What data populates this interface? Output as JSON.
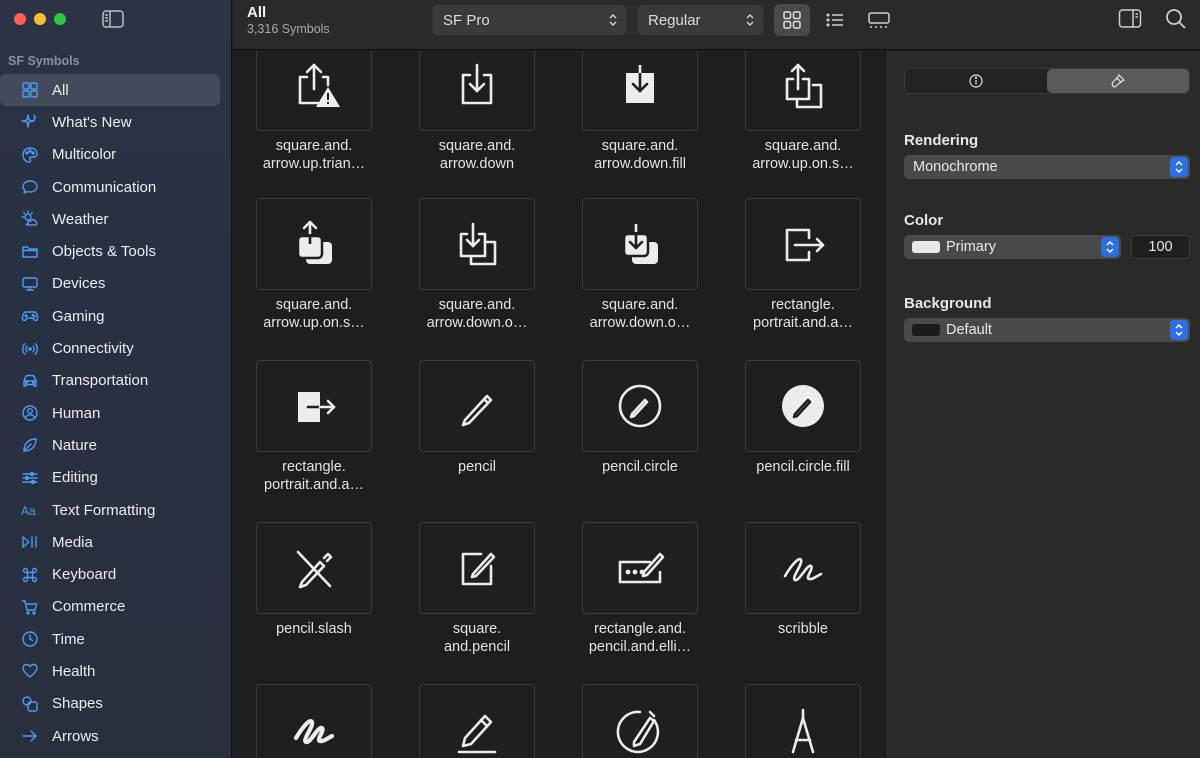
{
  "window": {
    "title": "All",
    "subtitle": "3,316 Symbols"
  },
  "sidebar": {
    "section": "SF Symbols",
    "items": [
      {
        "label": "All",
        "icon": "grid-icon",
        "active": true
      },
      {
        "label": "What's New",
        "icon": "sparkle-icon"
      },
      {
        "label": "Multicolor",
        "icon": "palette-icon"
      },
      {
        "label": "Communication",
        "icon": "message-bubble-icon"
      },
      {
        "label": "Weather",
        "icon": "sun-cloud-icon"
      },
      {
        "label": "Objects & Tools",
        "icon": "folder-icon"
      },
      {
        "label": "Devices",
        "icon": "display-icon"
      },
      {
        "label": "Gaming",
        "icon": "gamecontroller-icon"
      },
      {
        "label": "Connectivity",
        "icon": "antenna-icon"
      },
      {
        "label": "Transportation",
        "icon": "car-icon"
      },
      {
        "label": "Human",
        "icon": "person-icon"
      },
      {
        "label": "Nature",
        "icon": "leaf-icon"
      },
      {
        "label": "Editing",
        "icon": "sliders-icon"
      },
      {
        "label": "Text Formatting",
        "icon": "text-aa-icon"
      },
      {
        "label": "Media",
        "icon": "play-pause-icon"
      },
      {
        "label": "Keyboard",
        "icon": "command-icon"
      },
      {
        "label": "Commerce",
        "icon": "cart-icon"
      },
      {
        "label": "Time",
        "icon": "clock-icon"
      },
      {
        "label": "Health",
        "icon": "heart-icon"
      },
      {
        "label": "Shapes",
        "icon": "shapes-icon"
      },
      {
        "label": "Arrows",
        "icon": "arrow-right-icon"
      }
    ]
  },
  "toolbar": {
    "font_popup": "SF Pro",
    "weight_popup": "Regular",
    "view_modes": [
      "grid-view-icon",
      "list-view-icon",
      "gallery-view-icon"
    ]
  },
  "symbols": [
    {
      "name": "square.and.\narrow.up.trian…",
      "icon": "square-arrow-up-triangle-icon"
    },
    {
      "name": "square.and.\narrow.down",
      "icon": "square-arrow-down-icon"
    },
    {
      "name": "square.and.\narrow.down.fill",
      "icon": "square-arrow-down-fill-icon"
    },
    {
      "name": "square.and.\narrow.up.on.s…",
      "icon": "square-arrow-up-on-square-icon"
    },
    {
      "name": "square.and.\narrow.up.on.s…",
      "icon": "square-arrow-up-on-square-fill-icon"
    },
    {
      "name": "square.and.\narrow.down.o…",
      "icon": "square-arrow-down-on-square-icon"
    },
    {
      "name": "square.and.\narrow.down.o…",
      "icon": "square-arrow-down-on-square-fill-icon"
    },
    {
      "name": "rectangle.\nportrait.and.a…",
      "icon": "rectangle-portrait-arrow-right-icon"
    },
    {
      "name": "rectangle.\nportrait.and.a…",
      "icon": "rectangle-portrait-arrow-right-fill-icon"
    },
    {
      "name": "pencil",
      "icon": "pencil-icon"
    },
    {
      "name": "pencil.circle",
      "icon": "pencil-circle-icon"
    },
    {
      "name": "pencil.circle.fill",
      "icon": "pencil-circle-fill-icon"
    },
    {
      "name": "pencil.slash",
      "icon": "pencil-slash-icon"
    },
    {
      "name": "square.\nand.pencil",
      "icon": "square-and-pencil-icon"
    },
    {
      "name": "rectangle.and.\npencil.and.elli…",
      "icon": "rectangle-pencil-ellipsis-icon"
    },
    {
      "name": "scribble",
      "icon": "scribble-icon"
    },
    {
      "name": "",
      "icon": "scribble-variable-icon"
    },
    {
      "name": "",
      "icon": "pencil-line-icon"
    },
    {
      "name": "",
      "icon": "pencil-tip-crop-circle-icon"
    },
    {
      "name": "",
      "icon": "compass-drawing-icon"
    }
  ],
  "inspector": {
    "tabs": [
      "info-icon",
      "paintbrush-icon"
    ],
    "rendering_label": "Rendering",
    "rendering_value": "Monochrome",
    "color_label": "Color",
    "color_value": "Primary",
    "color_swatch": "#e8e8e8",
    "opacity_value": "100",
    "background_label": "Background",
    "background_value": "Default",
    "background_swatch": "#1a1a1a",
    "accent": "#2d6fe0"
  }
}
